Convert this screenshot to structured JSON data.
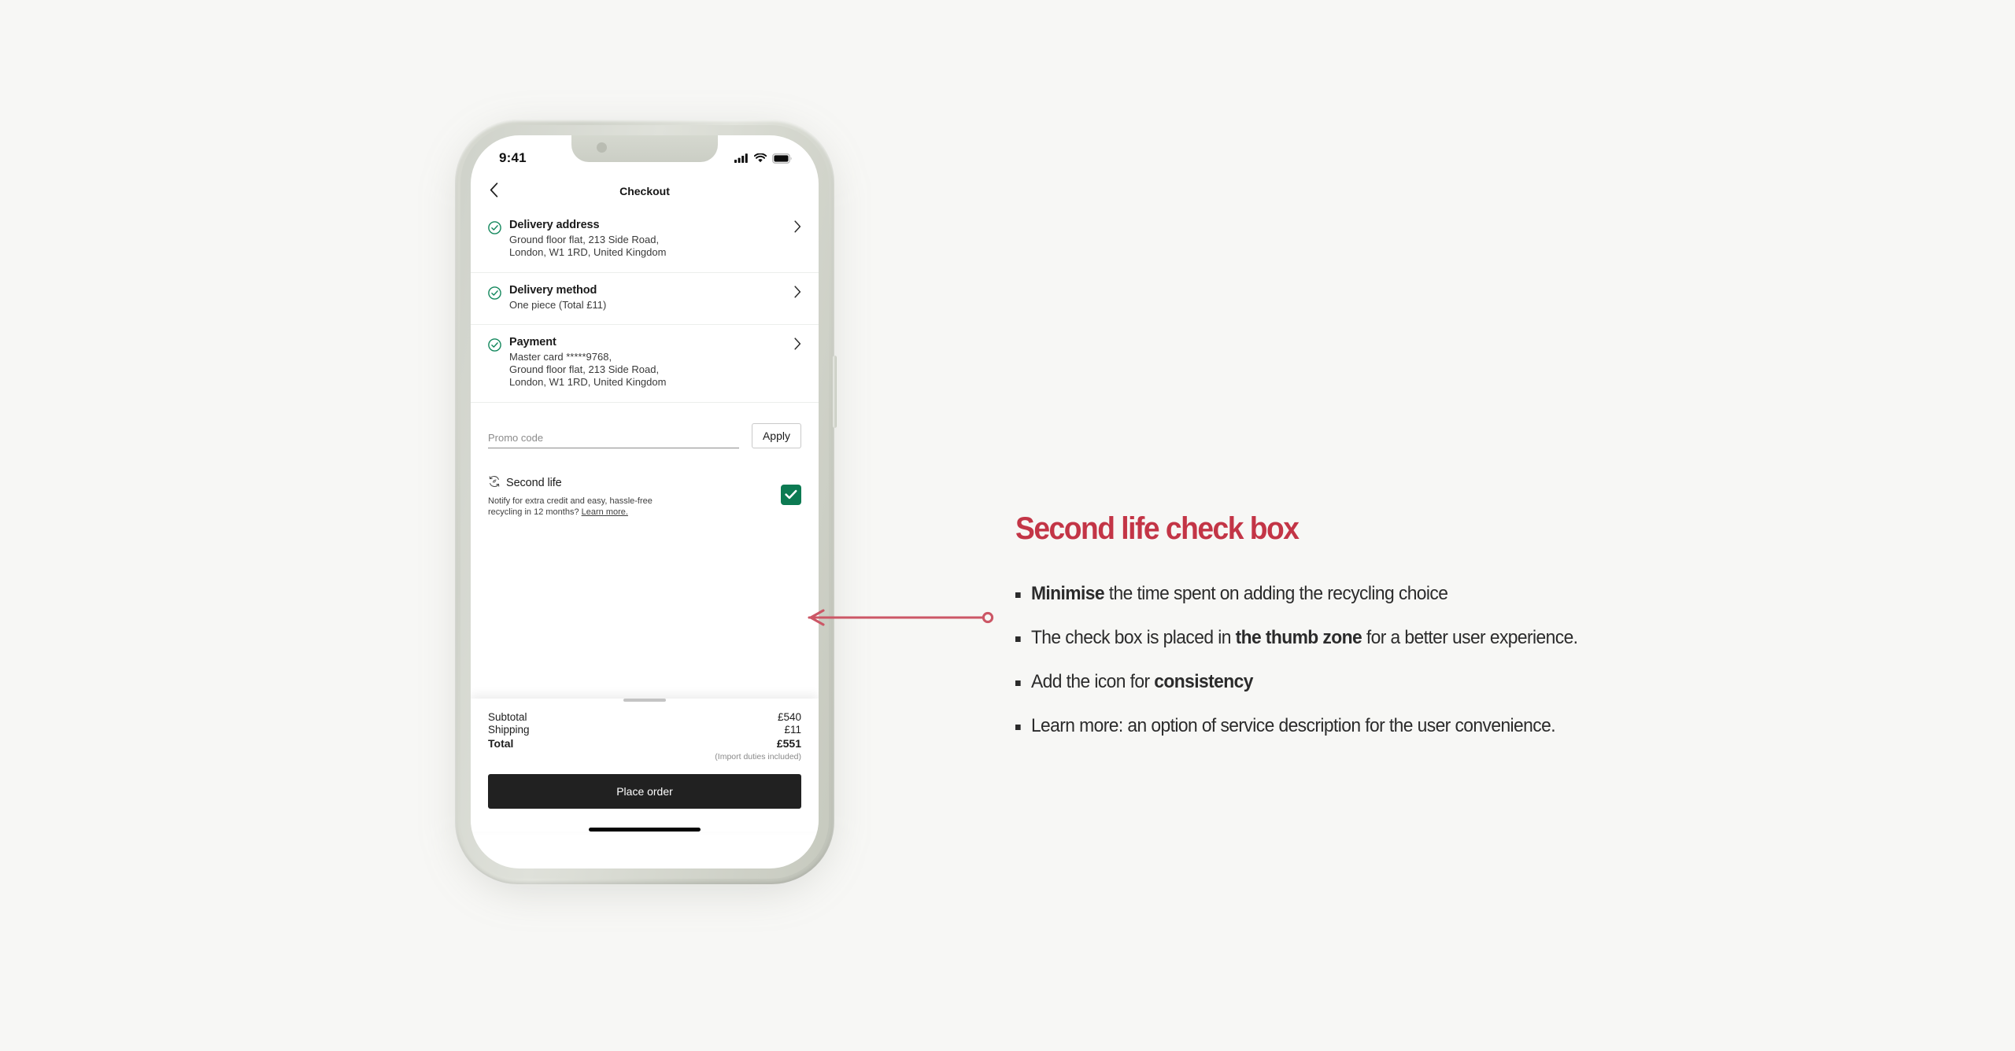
{
  "phone": {
    "status_bar": {
      "time": "9:41",
      "icons": [
        "cellular-signal-icon",
        "wifi-icon",
        "battery-icon"
      ]
    },
    "nav": {
      "back_icon": "chevron-left-icon",
      "title": "Checkout"
    },
    "summary_rows": [
      {
        "icon": "check-circle-icon",
        "title": "Delivery address",
        "lines": [
          "Ground floor flat, 213 Side Road,",
          "London, W1 1RD, United Kingdom"
        ],
        "chevron": "chevron-right-icon"
      },
      {
        "icon": "check-circle-icon",
        "title": "Delivery method",
        "lines": [
          "One piece (Total £11)"
        ],
        "chevron": "chevron-right-icon"
      },
      {
        "icon": "check-circle-icon",
        "title": "Payment",
        "lines": [
          "Master card *****9768,",
          "Ground floor flat, 213 Side Road,",
          "London, W1 1RD, United Kingdom"
        ],
        "chevron": "chevron-right-icon"
      }
    ],
    "promo": {
      "placeholder": "Promo code",
      "value": "",
      "apply_label": "Apply"
    },
    "second_life": {
      "icon": "recycle-leaf-icon",
      "title": "Second life",
      "description_line1": "Notify for extra credit and easy, hassle-free",
      "description_line2": "recycling in 12 months? ",
      "link_label": "Learn more.",
      "checked": true,
      "checkbox_color": "#0c7a52",
      "check_icon": "checkmark-icon"
    },
    "totals": {
      "rows": [
        {
          "label": "Subtotal",
          "value": "£540"
        },
        {
          "label": "Shipping",
          "value": "£11"
        }
      ],
      "grand": {
        "label": "Total",
        "value": "£551"
      },
      "note": "(Import duties included)",
      "place_order_label": "Place order"
    }
  },
  "annotation": {
    "title": "Second life check box",
    "title_color": "#c33546",
    "arrow_color": "#cc5766",
    "bullets": [
      {
        "bold_prefix": "Minimise",
        "rest": " the time spent on adding the recycling choice",
        "bold_mid": "",
        "tail": ""
      },
      {
        "prefix": "The check box is placed in ",
        "bold_mid": "the thumb zone",
        "tail": " for a better user experience."
      },
      {
        "prefix": "Add the icon for ",
        "bold_mid": "consistency",
        "tail": ""
      },
      {
        "prefix": "Learn more: an option of service description for the user convenience.",
        "bold_mid": "",
        "tail": ""
      }
    ]
  }
}
